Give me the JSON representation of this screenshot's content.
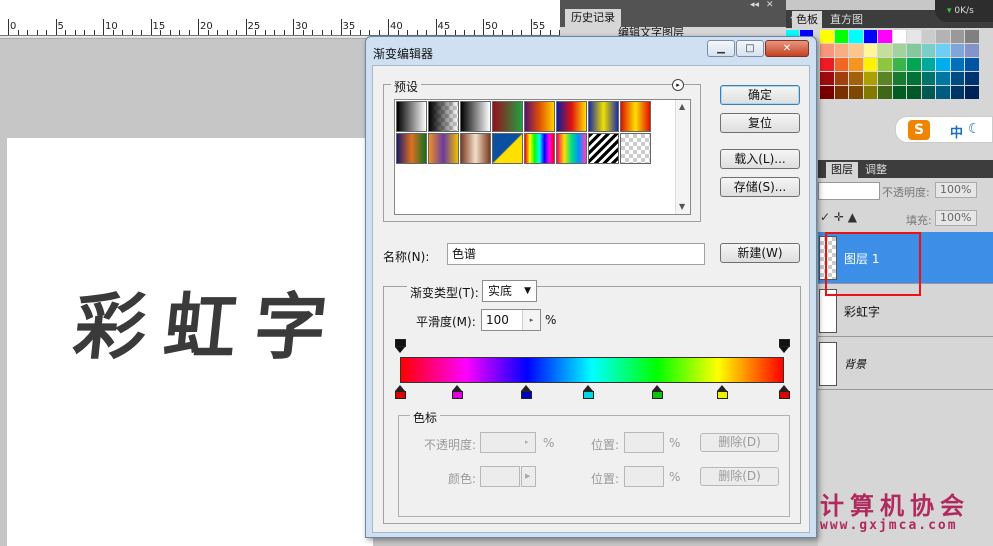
{
  "ruler": {
    "numbers": [
      "0",
      "5",
      "10",
      "15",
      "20",
      "25",
      "30",
      "35",
      "40",
      "45",
      "50",
      "55",
      "60"
    ]
  },
  "history_panel": {
    "tab_label": "历史记录",
    "item_label": "编辑文字图层",
    "collapse": "◂◂",
    "close": "✕"
  },
  "swatches_panel": {
    "tabs": [
      "色",
      "色板",
      "直方图"
    ],
    "side_colors": [
      "#00ffff",
      "#0000ff",
      "#ff00ff",
      "#ff0000"
    ],
    "colors": [
      "#ffff00",
      "#00ff00",
      "#00ffff",
      "#0000ff",
      "#ff00ff",
      "#ffffff",
      "#e6e6e6",
      "#cccccc",
      "#b3b3b3",
      "#999999",
      "#808080",
      "#f7977a",
      "#f9ad81",
      "#fdc68a",
      "#fff79a",
      "#c4df9b",
      "#a3d39c",
      "#82ca9d",
      "#7bcdc8",
      "#6ecff6",
      "#7ea7d8",
      "#8493ca",
      "#ed1c24",
      "#f26522",
      "#f7941d",
      "#fff200",
      "#8dc63f",
      "#39b54a",
      "#00a651",
      "#00a99d",
      "#00aeef",
      "#0072bc",
      "#0054a6",
      "#9e0b0f",
      "#a0410d",
      "#a3620a",
      "#aba000",
      "#598527",
      "#197b30",
      "#007236",
      "#00746b",
      "#0076a3",
      "#004b80",
      "#003471",
      "#790000",
      "#7b2e00",
      "#7d4900",
      "#827b00",
      "#406618",
      "#005e20",
      "#005826",
      "#005952",
      "#005b7f",
      "#003663",
      "#002157"
    ]
  },
  "net_speed": "0K/s",
  "ime": {
    "logo": "S",
    "lang": "中",
    "moon": "☾"
  },
  "layers_panel": {
    "tabs": [
      "图层",
      "调整"
    ],
    "opacity_label": "不透明度:",
    "opacity_value": "100%",
    "fill_label": "填充:",
    "fill_value": "100%",
    "locks": "✓ ✛ ▲",
    "layers": [
      {
        "name": "图层 1",
        "selected": true
      },
      {
        "name": "彩虹字",
        "selected": false
      },
      {
        "name": "背景",
        "selected": false
      }
    ]
  },
  "canvas": {
    "text": "彩虹字"
  },
  "watermark": {
    "title": "计算机协会",
    "url": "www.gxjmca.com"
  },
  "dialog": {
    "title": "渐变编辑器",
    "win_buttons": {
      "minimize": "▁",
      "maximize": "□",
      "close": "✕"
    },
    "presets_label": "预设",
    "presets_menu_icon": "▸",
    "preset_gradients": [
      "linear-gradient(to right,#000,#fff)",
      "linear-gradient(to right,#000,rgba(0,0,0,0)),repeating-conic-gradient(#ccc 0 25%,#fff 0 50%) 0 0/8px 8px",
      "linear-gradient(to right,#000,#fff)",
      "linear-gradient(to right,#9a0d1c,#22a040)",
      "linear-gradient(to right,#5a1070,#e05000,#ffd200)",
      "linear-gradient(to right,#0a1ea0,#e01010,#ffe000)",
      "linear-gradient(to right,#1a2da0,#f0e000,#1a2da0)",
      "linear-gradient(to right,#e01000,#ffe000,#e01000)",
      "linear-gradient(to right,#1a1a70,#e07020,#107020)",
      "linear-gradient(to right,#f09020,#6a3aa0,#f0c000)",
      "linear-gradient(to right,#7a3a20,#f3e0c8,#7a3a20)",
      "linear-gradient(135deg,#0a4fa0 48%,#ffe000 52%)",
      "linear-gradient(to right,#ff0000,#ffff00,#00ff00,#00ffff,#0000ff,#ff00ff,#ff0000)",
      "linear-gradient(to right,#ff0060,#ffe000,#00e080,#0090ff,#ff40c0)",
      "repeating-linear-gradient(135deg,#000 0 3px,#fff 3px 6px)",
      "repeating-conic-gradient(#ccc 0 25%,#fff 0 50%) 0 0/8px 8px"
    ],
    "buttons": {
      "ok": "确定",
      "reset": "复位",
      "load": "载入(L)...",
      "save": "存储(S)...",
      "new": "新建(W)"
    },
    "name_label": "名称(N):",
    "name_value": "色谱",
    "gradient_type_label": "渐变类型(T):",
    "gradient_type_value": "实底",
    "smoothness_label": "平滑度(M):",
    "smoothness_value": "100",
    "percent": "%",
    "gradient_preview": "linear-gradient(to right,#ff0000,#ff00ff 17%,#0000ff 33%,#00ffff 50%,#00ff00 67%,#ffff00 83%,#ff0000)",
    "color_stops": [
      {
        "color": "#e00000",
        "pos": 0.0
      },
      {
        "color": "#e000e0",
        "pos": 0.15
      },
      {
        "color": "#0000c0",
        "pos": 0.33
      },
      {
        "color": "#00d8e8",
        "pos": 0.49
      },
      {
        "color": "#10c010",
        "pos": 0.67
      },
      {
        "color": "#f0f000",
        "pos": 0.84
      },
      {
        "color": "#e00000",
        "pos": 1.0
      }
    ],
    "opacity_stops": [
      0.0,
      1.0
    ],
    "stops_section": {
      "label": "色标",
      "opacity_label": "不透明度:",
      "color_label": "颜色:",
      "location_label": "位置:",
      "delete_label": "删除(D)"
    }
  }
}
